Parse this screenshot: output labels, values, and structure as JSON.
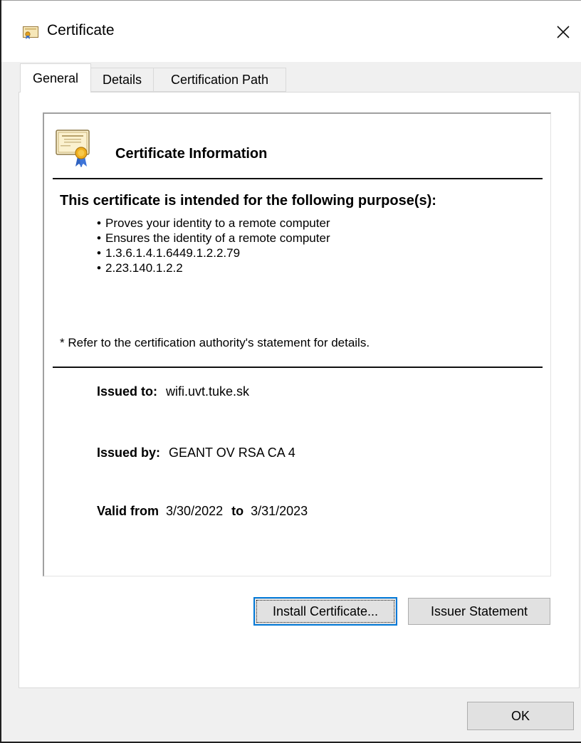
{
  "window": {
    "title": "Certificate"
  },
  "tabs": [
    {
      "label": "General",
      "selected": true
    },
    {
      "label": "Details",
      "selected": false
    },
    {
      "label": "Certification Path",
      "selected": false
    }
  ],
  "info": {
    "heading": "Certificate Information",
    "purpose_heading": "This certificate is intended for the following purpose(s):",
    "purposes": [
      "Proves your identity to a remote computer",
      "Ensures the identity of a remote computer",
      "1.3.6.1.4.1.6449.1.2.2.79",
      "2.23.140.1.2.2"
    ],
    "note": "* Refer to the certification authority's statement for details.",
    "issued_to_label": "Issued to:",
    "issued_to_value": "wifi.uvt.tuke.sk",
    "issued_by_label": "Issued by:",
    "issued_by_value": "GEANT OV RSA CA 4",
    "valid_from_label": "Valid from",
    "valid_from_value": "3/30/2022",
    "valid_to_label": "to",
    "valid_to_value": "3/31/2023"
  },
  "buttons": {
    "install": "Install Certificate...",
    "issuer": "Issuer Statement",
    "ok": "OK"
  },
  "colors": {
    "focus_border": "#0078d7",
    "button_bg": "#e1e1e1",
    "dialog_bg": "#f0f0f0"
  },
  "icons": {
    "title": "certificate-icon",
    "close": "close-icon",
    "info": "certificate-icon"
  }
}
